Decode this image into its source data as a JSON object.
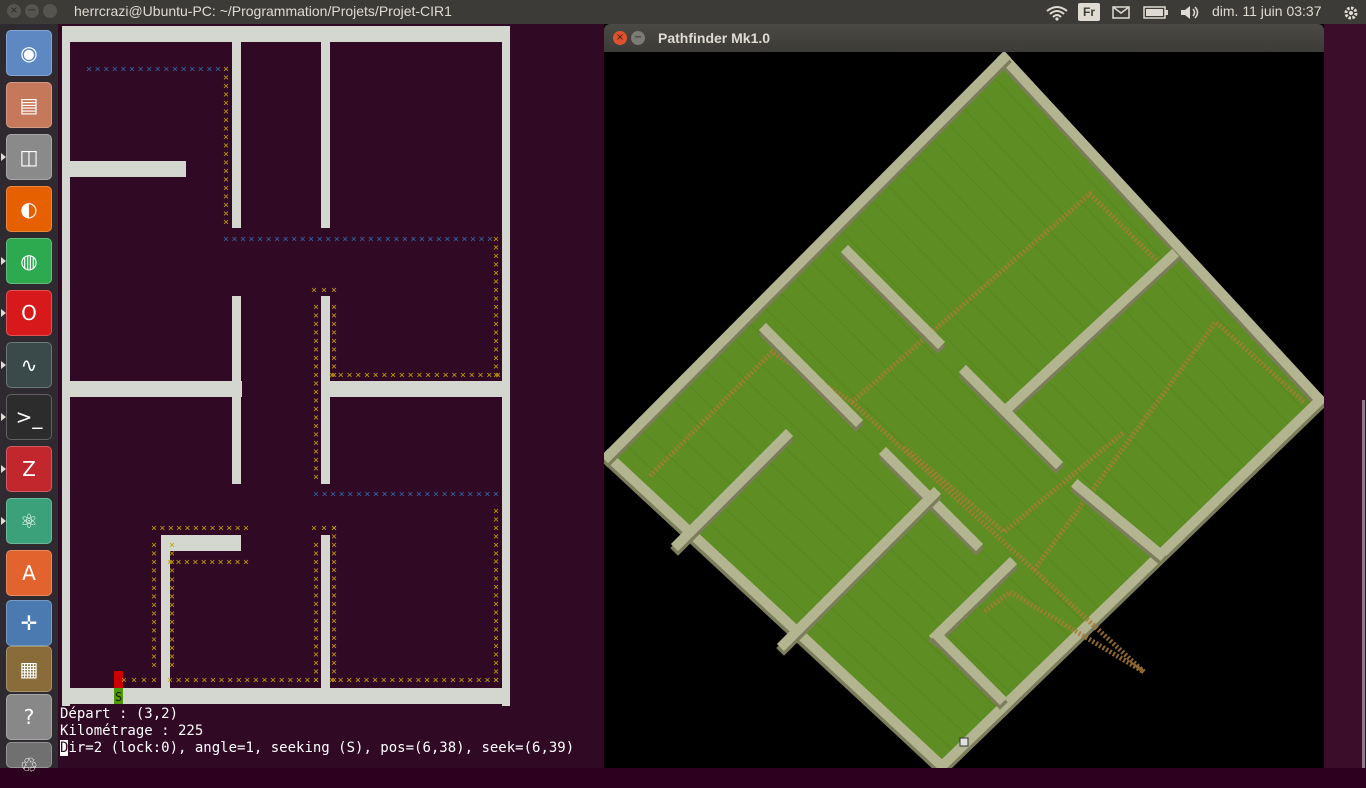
{
  "topbar": {
    "title": "herrcrazi@Ubuntu-PC: ~/Programmation/Projets/Projet-CIR1",
    "keyboard": "Fr",
    "clock": "dim. 11 juin 03:37",
    "close_glyph": "×",
    "min_glyph": "−",
    "icons": [
      "wifi-icon",
      "mail-icon",
      "battery-icon",
      "volume-icon",
      "gear-icon"
    ]
  },
  "launcher": {
    "items": [
      {
        "name": "ubuntu-dash",
        "glyph": "◉",
        "color": "#5e88c1"
      },
      {
        "name": "files",
        "glyph": "▤",
        "color": "#c6785a"
      },
      {
        "name": "disks",
        "glyph": "◫",
        "color": "#8a8a8a"
      },
      {
        "name": "firefox",
        "glyph": "◐",
        "color": "#e66000"
      },
      {
        "name": "chrome",
        "glyph": "◍",
        "color": "#2da94f"
      },
      {
        "name": "opera",
        "glyph": "O",
        "color": "#d7191c"
      },
      {
        "name": "system-monitor",
        "glyph": "∿",
        "color": "#3a4a4a"
      },
      {
        "name": "terminal",
        "glyph": ">_",
        "color": "#2c2c2c"
      },
      {
        "name": "filezilla",
        "glyph": "Z",
        "color": "#c1272d"
      },
      {
        "name": "atom",
        "glyph": "⚛",
        "color": "#3aa17a"
      },
      {
        "name": "software-center",
        "glyph": "A",
        "color": "#e2632d"
      },
      {
        "name": "navigation",
        "glyph": "✛",
        "color": "#4a7ab0"
      },
      {
        "name": "disk-manager",
        "glyph": "▦",
        "color": "#8a6c3a"
      },
      {
        "name": "help",
        "glyph": "?",
        "color": "#888888"
      },
      {
        "name": "trash",
        "glyph": "♲",
        "color": "#707070"
      }
    ]
  },
  "terminal": {
    "line1": "Départ : (3,2)",
    "line2": "Kilométrage : 225",
    "line3_cursor": "D",
    "line3": "ir=2 (lock:0), angle=1, seeking (S), pos=(6,38), seek=(6,39)",
    "start_marker": "S",
    "path_char": "×",
    "colors": {
      "background": "#300a24",
      "wall": "#d3d7cf",
      "path_gold": "#c4a000",
      "path_blue": "#3465a4",
      "start_red": "#cc0000",
      "start_green": "#4e9a06"
    }
  },
  "window": {
    "title": "Pathfinder Mk1.0",
    "close_glyph": "×",
    "min_glyph": "−",
    "colors": {
      "grass": "#5e8d24",
      "grass_dark": "#4c7a1a",
      "wall_top": "#b3b590",
      "wall_side": "#7c7d5a",
      "path": "#a77b36"
    }
  }
}
